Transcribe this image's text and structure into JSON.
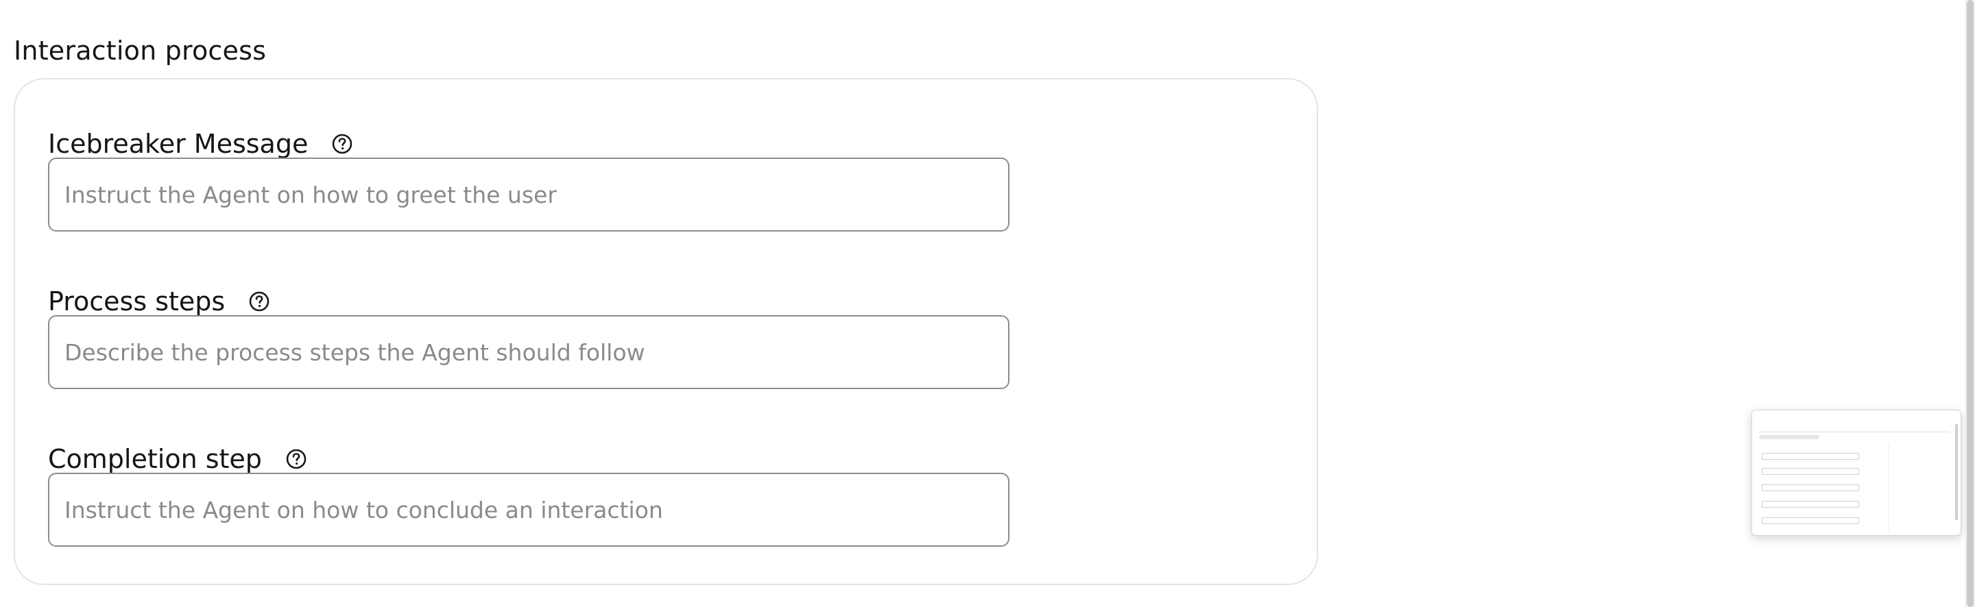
{
  "section": {
    "title": "Interaction process"
  },
  "fields": [
    {
      "label": "Icebreaker Message",
      "placeholder": "Instruct the Agent on how to greet the user",
      "value": "",
      "help_icon": "question-circle-icon"
    },
    {
      "label": "Process steps",
      "placeholder": "Describe the process steps the Agent should follow",
      "value": "",
      "help_icon": "question-circle-icon"
    },
    {
      "label": "Completion step",
      "placeholder": "Instruct the Agent on how to conclude an interaction",
      "value": "",
      "help_icon": "question-circle-icon"
    }
  ],
  "colors": {
    "card_border": "#e4e4e4",
    "input_border": "#8c8c8c",
    "placeholder": "#8a8a8a",
    "text": "#151515"
  }
}
